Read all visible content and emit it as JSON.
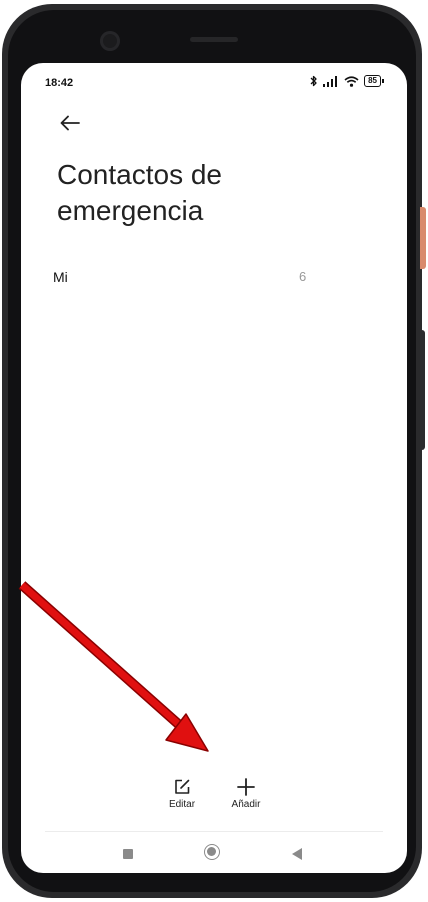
{
  "status_bar": {
    "time": "18:42",
    "battery": "85",
    "icons": [
      "bluetooth-icon",
      "signal-icon",
      "wifi-icon",
      "battery-icon"
    ]
  },
  "page": {
    "title_line1": "Contactos de",
    "title_line2": "emergencia"
  },
  "list": {
    "items": [
      {
        "label": "Mi",
        "count": "6"
      }
    ]
  },
  "bottom_actions": {
    "edit_label": "Editar",
    "add_label": "Añadir"
  },
  "colors": {
    "annotation_arrow": "#e01010",
    "side_button": "#d98a6c",
    "nav_gray": "#8a8a8a"
  }
}
